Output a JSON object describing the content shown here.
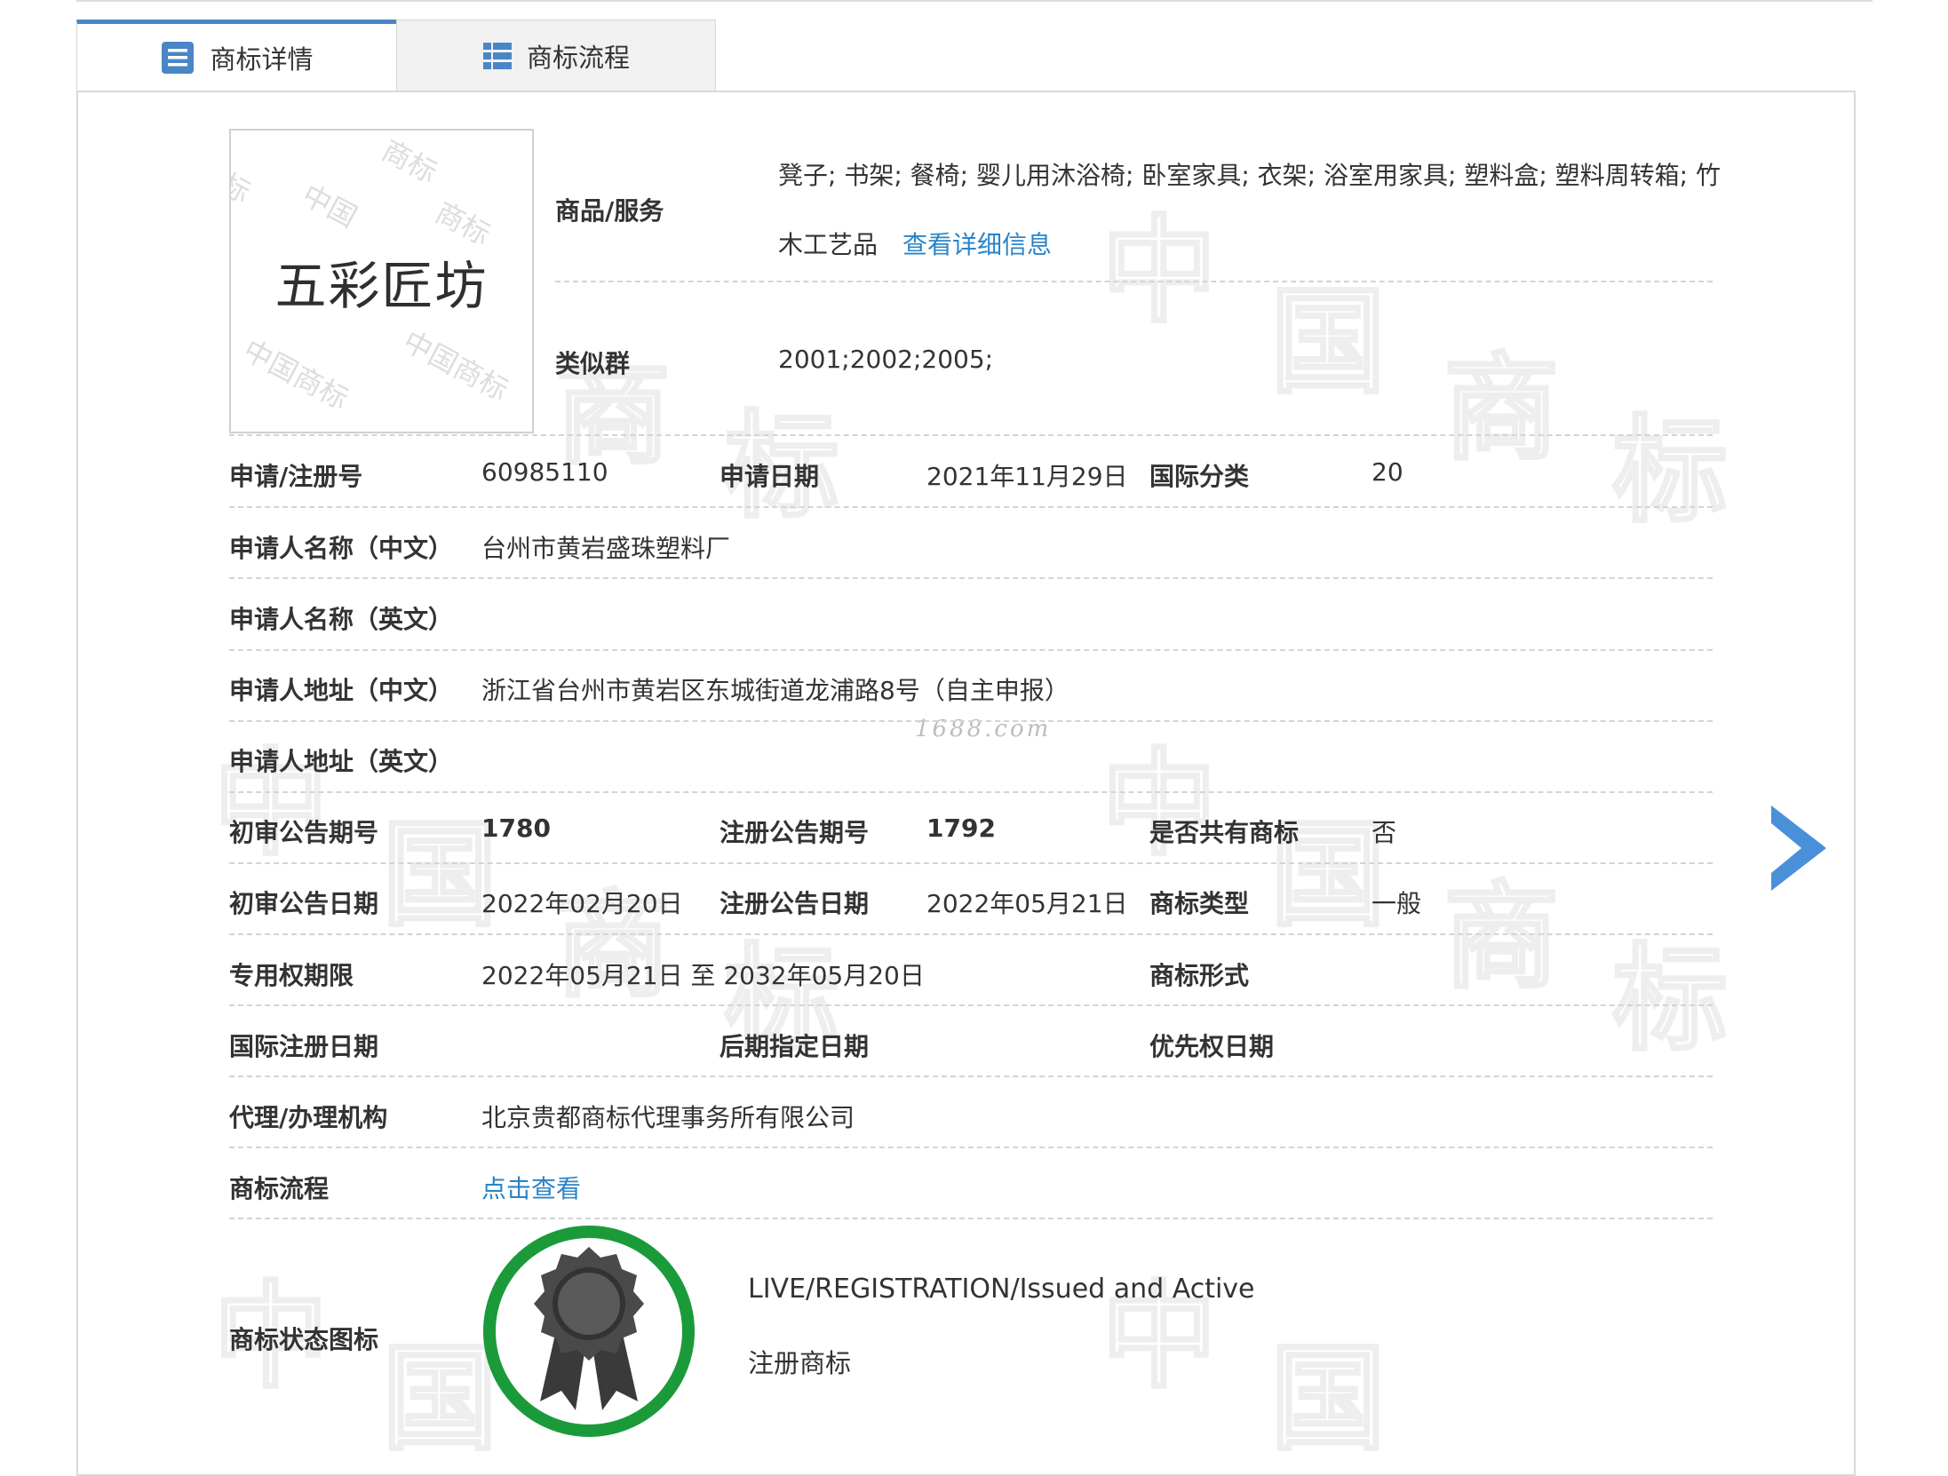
{
  "tabs": [
    {
      "label": "商标详情",
      "active": true
    },
    {
      "label": "商标流程",
      "active": false
    }
  ],
  "trademark_image_text": "五彩匠坊",
  "watermark_text": "1688.com",
  "goods": {
    "label": "商品/服务",
    "line1": "凳子; 书架; 餐椅; 婴儿用沐浴椅; 卧室家具; 衣架; 浴室用家具; 塑料盒; 塑料周转箱; 竹",
    "line2": "木工艺品",
    "detail_link": "查看详细信息"
  },
  "similar_group": {
    "label": "类似群",
    "value": "2001;2002;2005;"
  },
  "reg_no": {
    "label": "申请/注册号",
    "value": "60985110"
  },
  "app_date": {
    "label": "申请日期",
    "value": "2021年11月29日"
  },
  "intl_class": {
    "label": "国际分类",
    "value": "20"
  },
  "applicant_cn": {
    "label": "申请人名称（中文）",
    "value": "台州市黄岩盛珠塑料厂"
  },
  "applicant_en": {
    "label": "申请人名称（英文）",
    "value": ""
  },
  "address_cn": {
    "label": "申请人地址（中文）",
    "value": "浙江省台州市黄岩区东城街道龙浦路8号（自主申报）"
  },
  "address_en": {
    "label": "申请人地址（英文）",
    "value": ""
  },
  "prelim_issue": {
    "label": "初审公告期号",
    "value": "1780"
  },
  "reg_issue": {
    "label": "注册公告期号",
    "value": "1792"
  },
  "shared_tm": {
    "label": "是否共有商标",
    "value": "否"
  },
  "prelim_date": {
    "label": "初审公告日期",
    "value": "2022年02月20日"
  },
  "reg_date": {
    "label": "注册公告日期",
    "value": "2022年05月21日"
  },
  "tm_type": {
    "label": "商标类型",
    "value": "一般"
  },
  "exclusive_period": {
    "label": "专用权期限",
    "value": "2022年05月21日 至 2032年05月20日"
  },
  "tm_form": {
    "label": "商标形式",
    "value": ""
  },
  "intl_reg_date": {
    "label": "国际注册日期",
    "value": ""
  },
  "later_designation_date": {
    "label": "后期指定日期",
    "value": ""
  },
  "priority_date": {
    "label": "优先权日期",
    "value": ""
  },
  "agent": {
    "label": "代理/办理机构",
    "value": "北京贵都商标代理事务所有限公司"
  },
  "process": {
    "label": "商标流程",
    "link": "点击查看"
  },
  "status": {
    "label": "商标状态图标",
    "en": "LIVE/REGISTRATION/Issued and Active",
    "cn": "注册商标",
    "badge_icon": "award-ribbon-icon",
    "ring_color": "#1b9a3a"
  },
  "colors": {
    "accent": "#4a86c6",
    "link": "#2a84c8"
  }
}
